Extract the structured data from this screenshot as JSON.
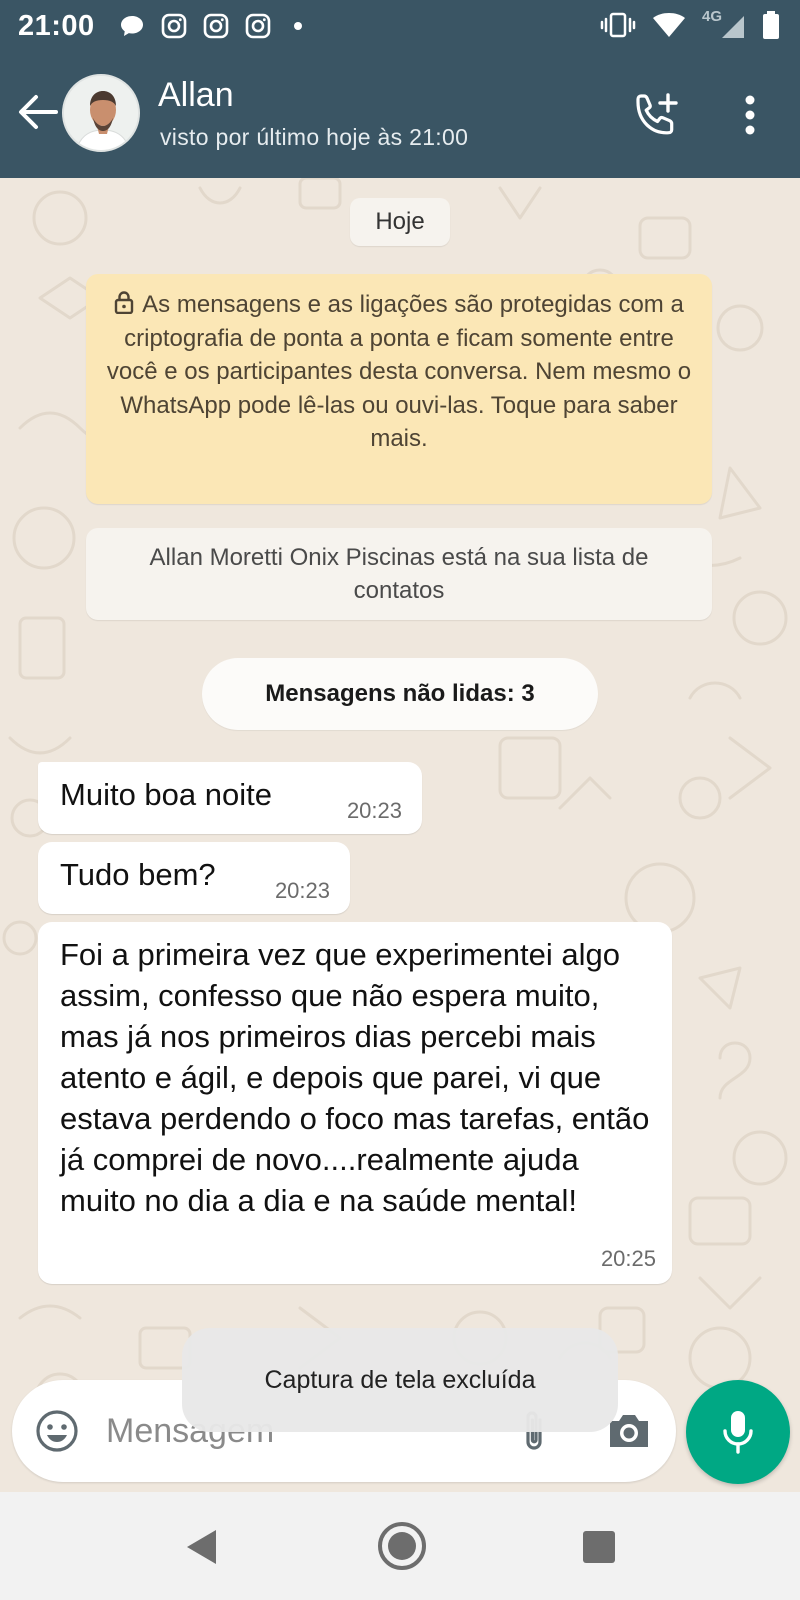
{
  "status_bar": {
    "time": "21:00",
    "network": "4G",
    "left_icons": [
      "chat-bubble-icon",
      "instagram-icon",
      "instagram-icon",
      "instagram-icon"
    ],
    "right_icons": [
      "vibrate-icon",
      "wifi-icon",
      "signal-icon",
      "battery-icon"
    ]
  },
  "header": {
    "contact_name": "Allan",
    "last_seen": "visto por último hoje às 21:00",
    "back_icon": "arrow-left-icon",
    "call_icon": "add-call-icon",
    "menu_icon": "more-vertical-icon",
    "background_color": "#3a5564"
  },
  "chat": {
    "date_label": "Hoje",
    "encryption_notice": "As mensagens e as ligações são protegidas com a criptografia de ponta a ponta e ficam somente entre você e os participantes desta conversa. Nem mesmo o WhatsApp pode lê-las ou ouvi-las. Toque para saber mais.",
    "contact_notice": "Allan Moretti Onix Piscinas está na sua lista de contatos",
    "unread_label": "Mensagens não lidas: 3",
    "messages": [
      {
        "text": "Muito boa noite",
        "time": "20:23"
      },
      {
        "text": "Tudo bem?",
        "time": "20:23"
      },
      {
        "text": "Foi a primeira vez que experimentei algo assim, confesso que não espera muito, mas já nos primeiros dias percebi mais atento e ágil, e depois que parei, vi que estava perdendo o foco mas tarefas, então já comprei de novo....realmente ajuda muito no dia a dia e na saúde mental!",
        "time": "20:25"
      }
    ]
  },
  "composer": {
    "placeholder": "Mensagem",
    "emoji_icon": "emoji-icon",
    "attach_icon": "paperclip-icon",
    "camera_icon": "camera-icon",
    "mic_icon": "microphone-icon",
    "accent_color": "#00a884"
  },
  "toast": {
    "text": "Captura de tela excluída"
  },
  "nav_bar": {
    "icons": [
      "nav-back-icon",
      "nav-home-icon",
      "nav-recents-icon"
    ]
  }
}
